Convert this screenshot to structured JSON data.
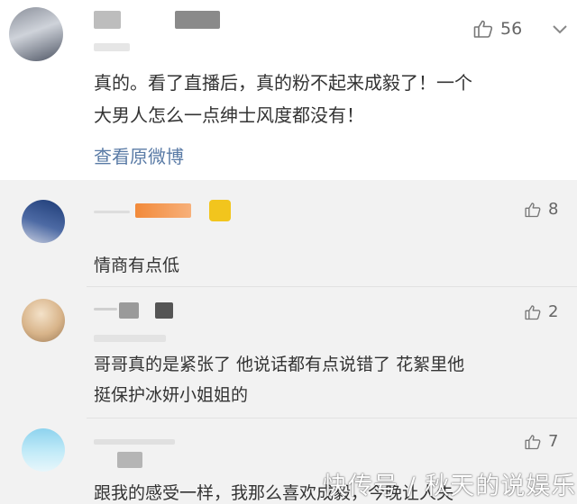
{
  "main_comment": {
    "like_count": "56",
    "text_line1": "真的。看了直播后，真的粉不起来成毅了！一个",
    "text_line2": "大男人怎么一点绅士风度都没有！",
    "view_original": "查看原微博"
  },
  "replies": [
    {
      "like_count": "8",
      "text_line1": "情商有点低",
      "text_line2": ""
    },
    {
      "like_count": "2",
      "text_line1": "哥哥真的是紧张了 他说话都有点说错了 花絮里他",
      "text_line2": "挺保护冰妍小姐姐的"
    },
    {
      "like_count": "7",
      "text_line1": "跟我的感受一样，我那么喜欢成毅，今晚让人失",
      "text_line2": ""
    }
  ],
  "watermark": "快传号 / 秋天的说娱乐",
  "colors": {
    "link": "#5a7ba6",
    "reply_bg": "#f2f2f2",
    "main_bg": "#ffffff"
  }
}
